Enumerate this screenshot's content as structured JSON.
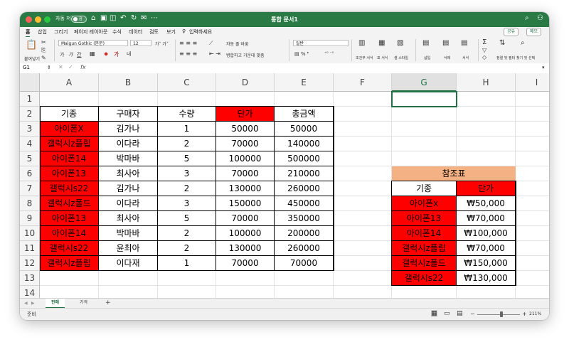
{
  "window": {
    "title": "통합 문서1",
    "autosave_label": "자동 저장",
    "autosave_state": "끔"
  },
  "menu": [
    "홈",
    "삽입",
    "그리기",
    "페이지 레이아웃",
    "수식",
    "데이터",
    "검토",
    "보기"
  ],
  "search_hint": "입력하세요",
  "share_label": "공유",
  "memo_label": "메모",
  "ribbon": {
    "paste": "붙여넣기",
    "font_name": "Malgun Gothic (본문)",
    "font_size": "12",
    "wrap_text": "자동 줄 바꿈",
    "merge_center": "병합하고 가운데 맞춤",
    "number_format": "일반",
    "cond_format": "조건부 서식",
    "table_format": "표 서식",
    "cell_style": "셀 스타일",
    "insert": "삽입",
    "delete": "삭제",
    "format": "서식",
    "sort_filter": "정렬 및 필터",
    "find_select": "찾기 및 선택"
  },
  "formula_bar": {
    "name_box": "G1",
    "fx": "fx",
    "content": ""
  },
  "columns": [
    "A",
    "B",
    "C",
    "D",
    "E",
    "F",
    "G",
    "H",
    "I"
  ],
  "rows": [
    "1",
    "2",
    "3",
    "4",
    "5",
    "6",
    "7",
    "8",
    "9",
    "10",
    "11",
    "12",
    "13",
    "14"
  ],
  "main_table": {
    "headers": [
      "기종",
      "구매자",
      "수량",
      "단가",
      "총금액"
    ],
    "rows": [
      [
        "아이폰X",
        "김가나",
        "1",
        "50000",
        "50000"
      ],
      [
        "갤럭시z플립",
        "이다라",
        "2",
        "70000",
        "140000"
      ],
      [
        "아이폰14",
        "박마바",
        "5",
        "100000",
        "500000"
      ],
      [
        "아이폰13",
        "최사아",
        "3",
        "70000",
        "210000"
      ],
      [
        "갤럭시s22",
        "김가나",
        "2",
        "130000",
        "260000"
      ],
      [
        "갤럭시z폴드",
        "이다라",
        "3",
        "150000",
        "450000"
      ],
      [
        "아이폰13",
        "최사아",
        "5",
        "70000",
        "350000"
      ],
      [
        "아이폰14",
        "박마바",
        "2",
        "100000",
        "200000"
      ],
      [
        "갤럭시s22",
        "윤최아",
        "2",
        "130000",
        "260000"
      ],
      [
        "갤럭시z플립",
        "이다재",
        "1",
        "70000",
        "70000"
      ]
    ]
  },
  "ref_table": {
    "title": "참조표",
    "headers": [
      "기종",
      "단가"
    ],
    "rows": [
      [
        "아이폰x",
        "₩50,000"
      ],
      [
        "아이폰13",
        "₩70,000"
      ],
      [
        "아이폰14",
        "₩100,000"
      ],
      [
        "갤럭시z플립",
        "₩70,000"
      ],
      [
        "갤럭시z폴드",
        "₩150,000"
      ],
      [
        "갤럭시s22",
        "₩130,000"
      ]
    ]
  },
  "sheets": [
    "판매",
    "가격"
  ],
  "active_sheet": "판매",
  "status": {
    "ready": "준비",
    "zoom": "211%"
  },
  "colors": {
    "header_red": "#ff0000",
    "ref_title": "#f4b183",
    "excel_green": "#217346"
  }
}
